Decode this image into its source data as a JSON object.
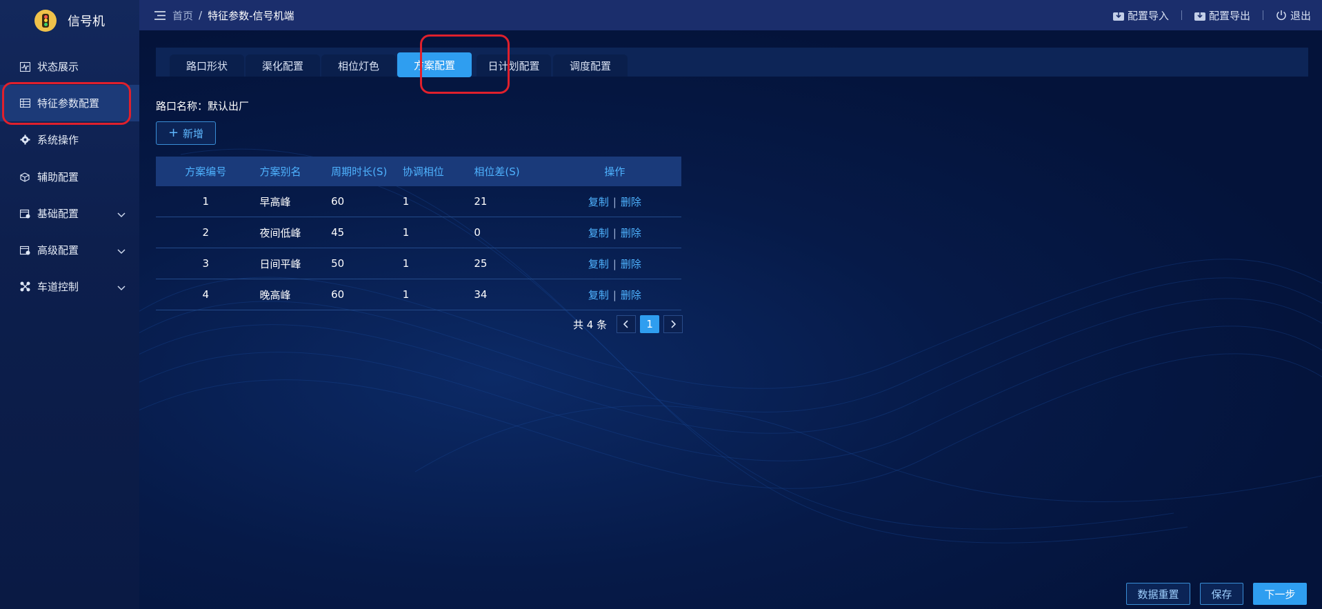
{
  "app": {
    "title": "信号机"
  },
  "sidebar": {
    "items": [
      {
        "label": "状态展示",
        "icon": "pulse-chart-icon"
      },
      {
        "label": "特征参数配置",
        "icon": "table-grid-icon",
        "active": true
      },
      {
        "label": "系统操作",
        "icon": "gear-icon"
      },
      {
        "label": "辅助配置",
        "icon": "cube-icon"
      },
      {
        "label": "基础配置",
        "icon": "calendar-settings-icon",
        "expandable": true
      },
      {
        "label": "高级配置",
        "icon": "calendar-settings-icon",
        "expandable": true
      },
      {
        "label": "车道控制",
        "icon": "lane-control-icon",
        "expandable": true
      }
    ]
  },
  "header": {
    "breadcrumb": {
      "home": "首页",
      "separator": "/",
      "current": "特征参数-信号机端"
    },
    "actions": {
      "import": "配置导入",
      "export": "配置导出",
      "logout": "退出"
    }
  },
  "tabs": [
    {
      "label": "路口形状"
    },
    {
      "label": "渠化配置"
    },
    {
      "label": "相位灯色"
    },
    {
      "label": "方案配置",
      "active": true
    },
    {
      "label": "日计划配置"
    },
    {
      "label": "调度配置"
    }
  ],
  "content": {
    "road_name_label": "路口名称：默认出厂",
    "add_button": "新增",
    "table": {
      "headers": [
        "方案编号",
        "方案别名",
        "周期时长(S)",
        "协调相位",
        "相位差(S)",
        "操作"
      ],
      "rows": [
        {
          "id": "1",
          "name": "早高峰",
          "cycle": "60",
          "coord": "1",
          "offset": "21"
        },
        {
          "id": "2",
          "name": "夜间低峰",
          "cycle": "45",
          "coord": "1",
          "offset": "0"
        },
        {
          "id": "3",
          "name": "日间平峰",
          "cycle": "50",
          "coord": "1",
          "offset": "25"
        },
        {
          "id": "4",
          "name": "晚高峰",
          "cycle": "60",
          "coord": "1",
          "offset": "34"
        }
      ],
      "op_copy": "复制",
      "op_delete": "删除",
      "op_separator": "|"
    },
    "pagination": {
      "total": "共 4 条",
      "current_page": "1"
    }
  },
  "footer": {
    "reset": "数据重置",
    "save": "保存",
    "next": "下一步"
  },
  "colors": {
    "accent": "#2f9ef0",
    "highlight_box": "#e0202c",
    "link": "#4fb3ff"
  }
}
